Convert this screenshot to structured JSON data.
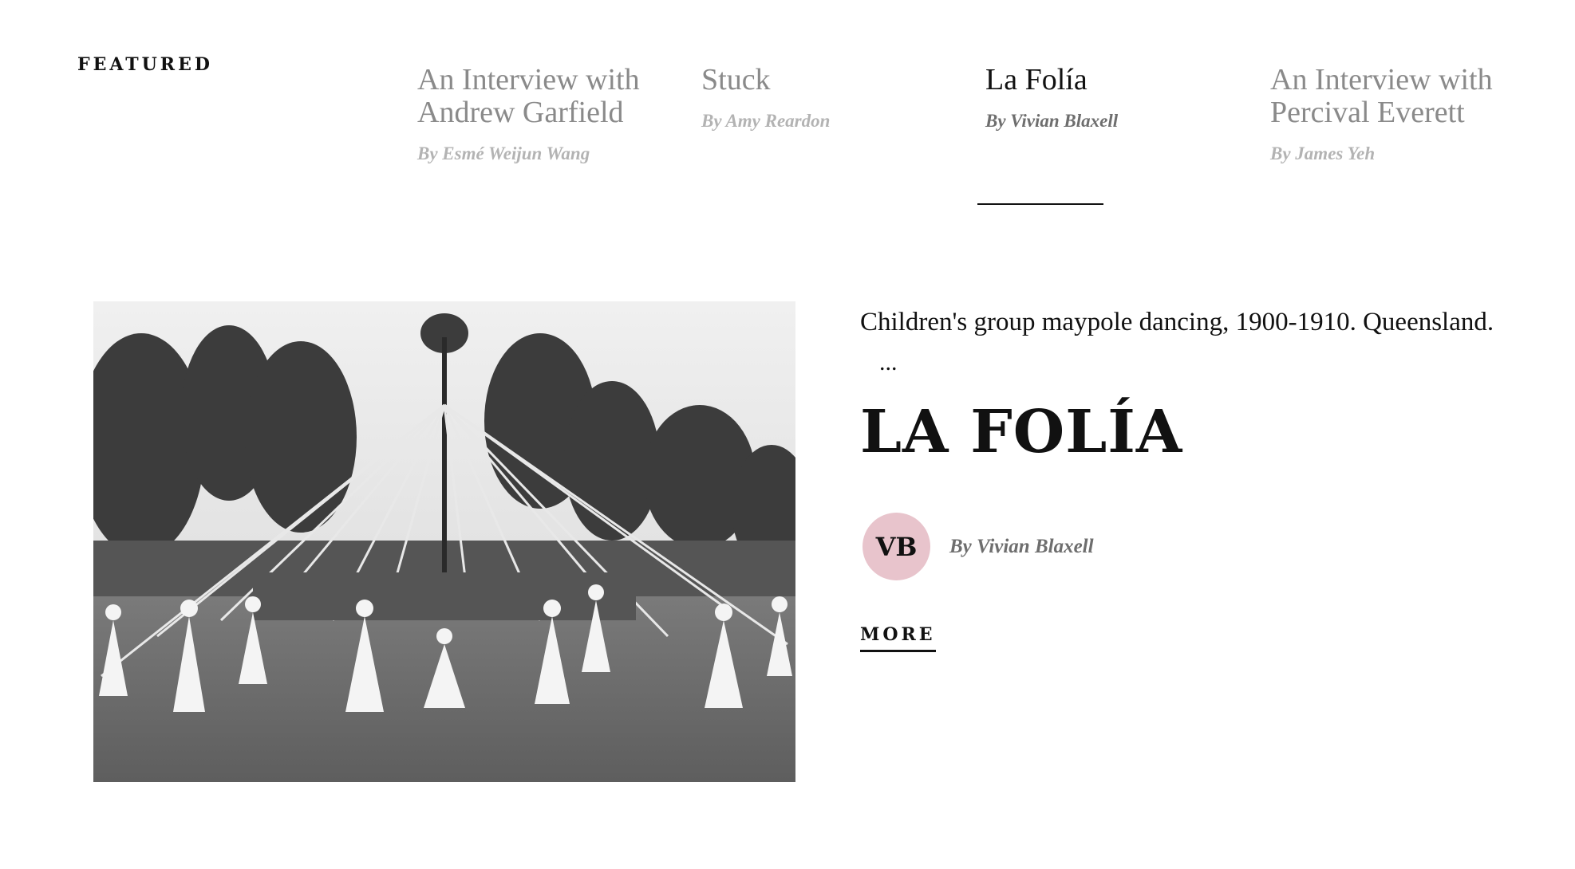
{
  "section": {
    "label": "FEATURED"
  },
  "tabs": [
    {
      "title": "An Interview with Andrew Garfield",
      "author": "By Esmé Weijun Wang",
      "active": false
    },
    {
      "title": "Stuck",
      "author": "By Amy Reardon",
      "active": false
    },
    {
      "title": "La Folía",
      "author": "By Vivian Blaxell",
      "active": true
    },
    {
      "title": "An Interview with Percival Everett",
      "author": "By James Yeh",
      "active": false
    }
  ],
  "feature": {
    "caption": "Children's group maypole dancing, 1900-1910. Queensland.",
    "ellipsis": "...",
    "headline": "LA FOLÍA",
    "avatar_initials": "VB",
    "avatar_color": "#e8c4cc",
    "byline": "By Vivian Blaxell",
    "more_label": "MORE"
  }
}
